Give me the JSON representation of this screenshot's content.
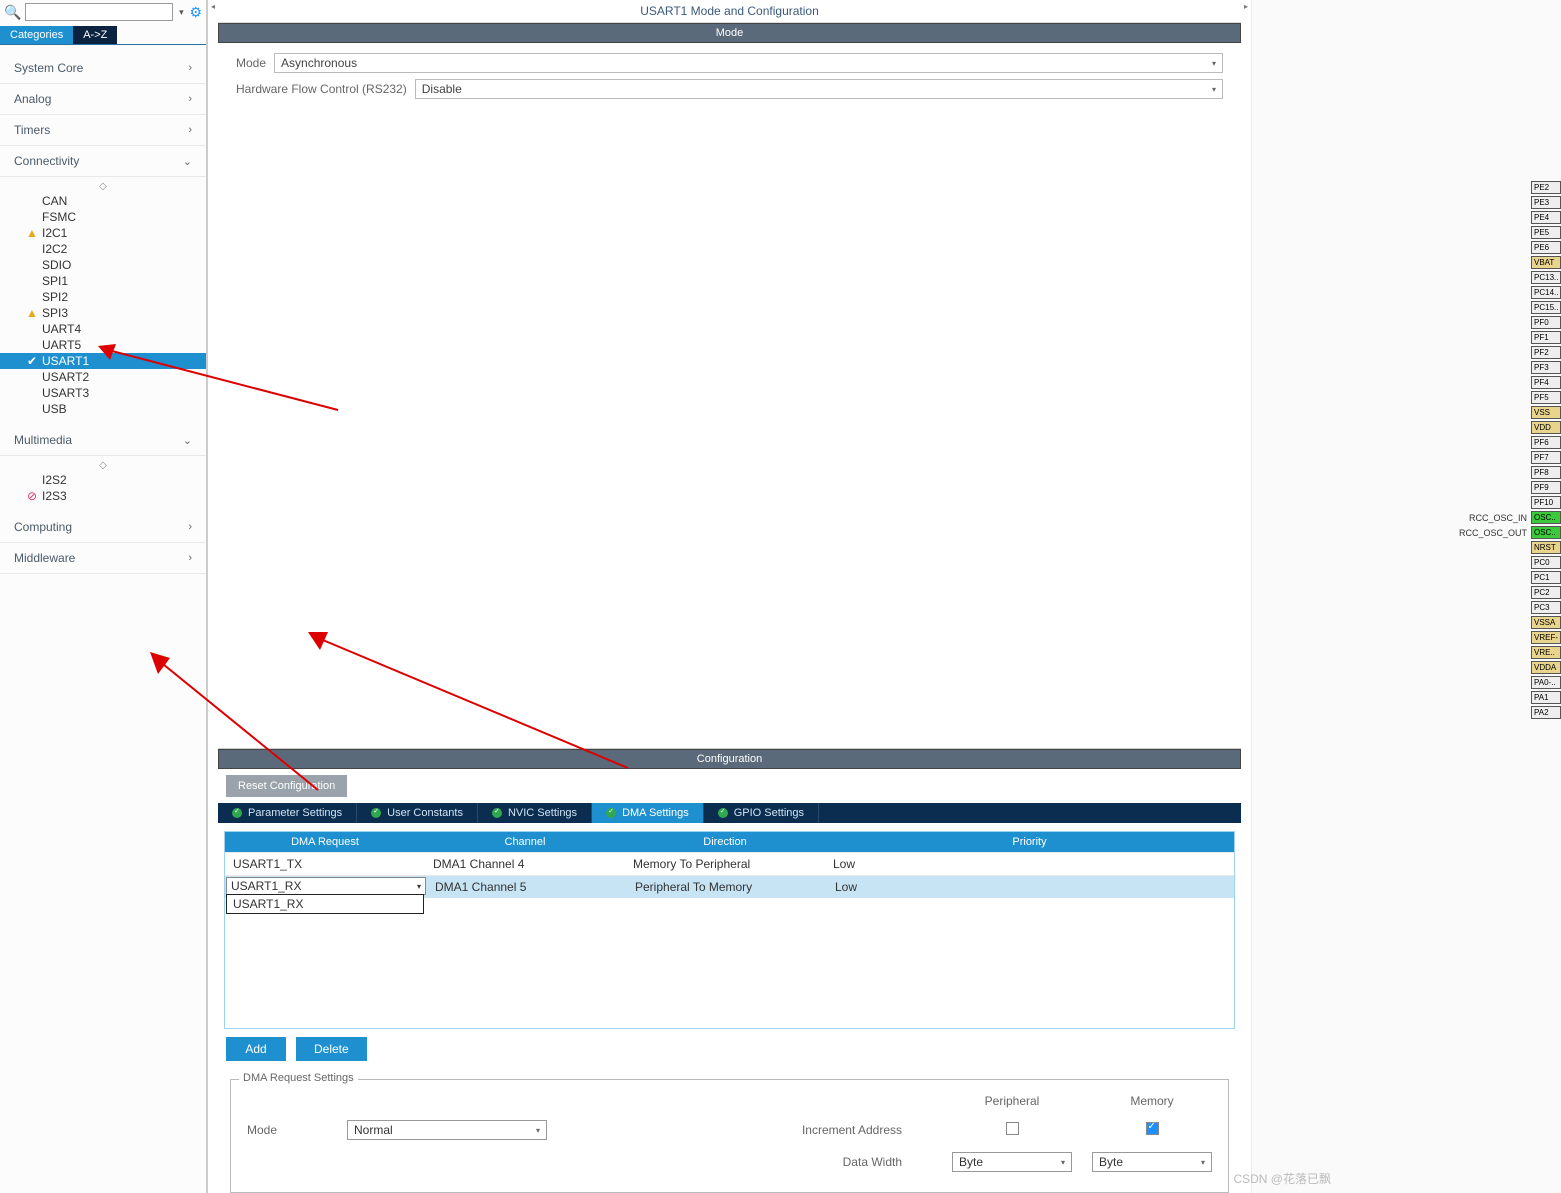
{
  "sidebar": {
    "tabs": {
      "categories": "Categories",
      "az": "A->Z"
    },
    "groups": {
      "system_core": "System Core",
      "analog": "Analog",
      "timers": "Timers",
      "connectivity": "Connectivity",
      "multimedia": "Multimedia",
      "computing": "Computing",
      "middleware": "Middleware"
    },
    "connectivity_items": [
      {
        "label": "CAN",
        "status": ""
      },
      {
        "label": "FSMC",
        "status": ""
      },
      {
        "label": "I2C1",
        "status": "warn"
      },
      {
        "label": "I2C2",
        "status": ""
      },
      {
        "label": "SDIO",
        "status": ""
      },
      {
        "label": "SPI1",
        "status": ""
      },
      {
        "label": "SPI2",
        "status": ""
      },
      {
        "label": "SPI3",
        "status": "warn"
      },
      {
        "label": "UART4",
        "status": ""
      },
      {
        "label": "UART5",
        "status": ""
      },
      {
        "label": "USART1",
        "status": "ok",
        "selected": true
      },
      {
        "label": "USART2",
        "status": ""
      },
      {
        "label": "USART3",
        "status": ""
      },
      {
        "label": "USB",
        "status": ""
      }
    ],
    "multimedia_items": [
      {
        "label": "I2S2",
        "status": ""
      },
      {
        "label": "I2S3",
        "status": "err"
      }
    ]
  },
  "main": {
    "title": "USART1 Mode and Configuration",
    "mode_bar": "Mode",
    "config_bar": "Configuration",
    "mode_label": "Mode",
    "mode_value": "Asynchronous",
    "flow_label": "Hardware Flow Control (RS232)",
    "flow_value": "Disable",
    "reset_button": "Reset Configuration",
    "cfg_tabs": {
      "param": "Parameter Settings",
      "user": "User Constants",
      "nvic": "NVIC Settings",
      "dma": "DMA Settings",
      "gpio": "GPIO Settings"
    },
    "dma_headers": {
      "req": "DMA Request",
      "chan": "Channel",
      "dir": "Direction",
      "pri": "Priority"
    },
    "dma_rows": [
      {
        "req": "USART1_TX",
        "chan": "DMA1 Channel 4",
        "dir": "Memory To Peripheral",
        "pri": "Low"
      },
      {
        "req": "USART1_RX",
        "chan": "DMA1 Channel 5",
        "dir": "Peripheral To Memory",
        "pri": "Low",
        "selected": true
      }
    ],
    "dma_popup": "USART1_RX",
    "add_button": "Add",
    "delete_button": "Delete",
    "settings_legend": "DMA Request Settings",
    "settings": {
      "mode_label": "Mode",
      "mode_value": "Normal",
      "peripheral": "Peripheral",
      "memory": "Memory",
      "inc_addr": "Increment Address",
      "data_width": "Data Width",
      "periph_width": "Byte",
      "mem_width": "Byte"
    }
  },
  "pins": {
    "labels": {
      "osc_in": "RCC_OSC_IN",
      "osc_out": "RCC_OSC_OUT"
    },
    "items": [
      {
        "name": "PE2"
      },
      {
        "name": "PE3"
      },
      {
        "name": "PE4"
      },
      {
        "name": "PE5"
      },
      {
        "name": "PE6"
      },
      {
        "name": "VBAT",
        "cls": "gold"
      },
      {
        "name": "PC13.."
      },
      {
        "name": "PC14.."
      },
      {
        "name": "PC15.."
      },
      {
        "name": "PF0"
      },
      {
        "name": "PF1"
      },
      {
        "name": "PF2"
      },
      {
        "name": "PF3"
      },
      {
        "name": "PF4"
      },
      {
        "name": "PF5"
      },
      {
        "name": "VSS",
        "cls": "gold"
      },
      {
        "name": "VDD",
        "cls": "gold"
      },
      {
        "name": "PF6"
      },
      {
        "name": "PF7"
      },
      {
        "name": "PF8"
      },
      {
        "name": "PF9"
      },
      {
        "name": "PF10"
      },
      {
        "name": "OSC..",
        "cls": "green",
        "label": "osc_in"
      },
      {
        "name": "OSC..",
        "cls": "green",
        "label": "osc_out"
      },
      {
        "name": "NRST",
        "cls": "gold"
      },
      {
        "name": "PC0"
      },
      {
        "name": "PC1"
      },
      {
        "name": "PC2"
      },
      {
        "name": "PC3"
      },
      {
        "name": "VSSA",
        "cls": "gold"
      },
      {
        "name": "VREF-",
        "cls": "gold"
      },
      {
        "name": "VRE..",
        "cls": "gold"
      },
      {
        "name": "VDDA",
        "cls": "gold"
      },
      {
        "name": "PA0-.."
      },
      {
        "name": "PA1"
      },
      {
        "name": "PA2"
      }
    ]
  },
  "watermark": "CSDN @花落已飘"
}
